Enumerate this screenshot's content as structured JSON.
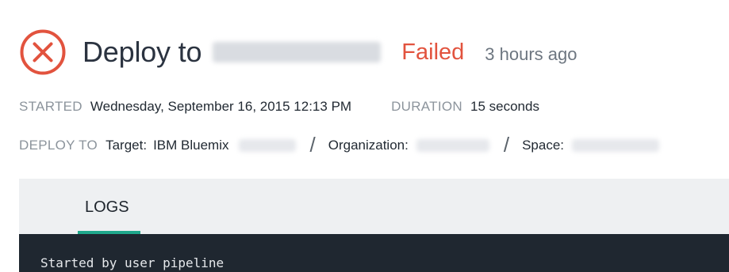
{
  "header": {
    "status_icon": "error-circle-x-icon",
    "title_prefix": "Deploy to",
    "status": "Failed",
    "time_ago": "3 hours ago"
  },
  "meta": {
    "started_label": "STARTED",
    "started_value": "Wednesday, September 16, 2015 12:13 PM",
    "duration_label": "DURATION",
    "duration_value": "15 seconds",
    "deploy_to_label": "DEPLOY TO",
    "target_label": "Target:",
    "target_value": "IBM Bluemix",
    "separator": "/",
    "organization_label": "Organization:",
    "space_label": "Space:"
  },
  "tabs": [
    {
      "label": "LOGS",
      "active": true
    }
  ],
  "logs": {
    "lines": [
      "Started by user pipeline"
    ]
  },
  "colors": {
    "failed": "#e2533e",
    "tab_accent": "#1fa88c",
    "log_background": "#1f2730",
    "tab_bar_background": "#eef0f2"
  }
}
